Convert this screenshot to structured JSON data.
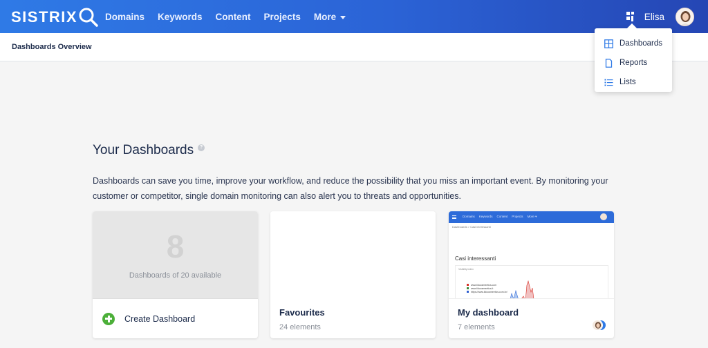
{
  "app": {
    "logo": "SISTRIX",
    "nav": [
      "Domains",
      "Keywords",
      "Content",
      "Projects",
      "More"
    ],
    "user_name": "Elisa"
  },
  "subheader": {
    "title": "Dashboards Overview"
  },
  "dropdown": {
    "items": [
      {
        "label": "Dashboards",
        "icon": "dashboard-icon"
      },
      {
        "label": "Reports",
        "icon": "document-icon"
      },
      {
        "label": "Lists",
        "icon": "list-icon"
      }
    ]
  },
  "main": {
    "title": "Your Dashboards",
    "help": "?",
    "description": "Dashboards can save you time, improve your workflow, and reduce the possibility that you miss an important event. By monitoring your customer or competitor, single domain monitoring can also alert you to threats and opportunities."
  },
  "cards": {
    "create": {
      "count": "8",
      "available": "Dashboards of 20 available",
      "label": "Create Dashboard"
    },
    "favourites": {
      "name": "Favourites",
      "count": "24 elements"
    },
    "my_dashboard": {
      "name": "My dashboard",
      "count": "7 elements",
      "preview": {
        "nav": [
          "Domains",
          "Keywords",
          "Content",
          "Projects",
          "More ▾"
        ],
        "crumb": "Dashboards  >  Casi interessanti",
        "title": "Casi interessanti",
        "box_label": "Visibility index",
        "legend": [
          "www.lidoosmeetics.com",
          "www.lidoosmeetics.it",
          "https://www.lidoosmeetics.com.br/"
        ]
      }
    }
  },
  "colors": {
    "brand": "#2b63d6",
    "accent_green": "#4caf39",
    "text": "#1b2a4a"
  }
}
